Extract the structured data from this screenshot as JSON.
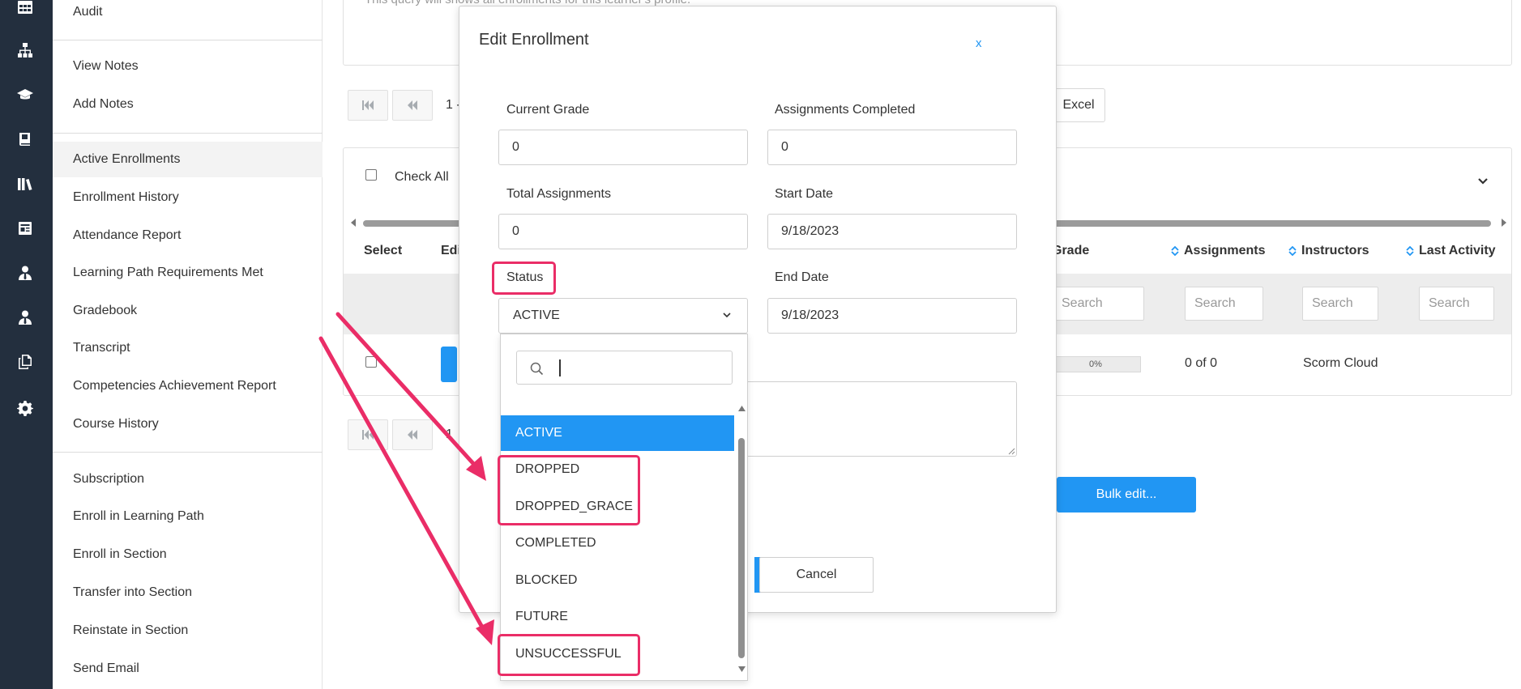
{
  "rail": {
    "icons": [
      "table-icon",
      "sitemap-icon",
      "graduation-cap-icon",
      "book-icon",
      "library-icon",
      "newspaper-icon",
      "user-tie-icon",
      "user-tie-icon",
      "copy-icon",
      "gear-icon"
    ]
  },
  "sidebar": {
    "groups": [
      [
        "Audit"
      ],
      [
        "View Notes",
        "Add Notes"
      ],
      [
        "Active Enrollments",
        "Enrollment History",
        "Attendance Report",
        "Learning Path Requirements Met",
        "Gradebook",
        "Transcript",
        "Competencies Achievement Report",
        "Course History"
      ],
      [
        "Subscription",
        "Enroll in Learning Path",
        "Enroll in Section",
        "Transfer into Section",
        "Reinstate in Section",
        "Send Email"
      ]
    ],
    "active_item": "Active Enrollments"
  },
  "background": {
    "query_text": "This query will shows all enrollments for this learner's profile.",
    "pager_text_top": "1 -",
    "pager_text_bottom": "1",
    "excel_label": "Excel",
    "check_all_label": "Check All",
    "columns": {
      "select": "Select",
      "edit": "Edi",
      "grade": "Grade",
      "assignments": "Assignments",
      "instructors": "Instructors",
      "last_activity": "Last Activity"
    },
    "search_placeholder": "Search",
    "row": {
      "progress": "0%",
      "assignments": "0 of 0",
      "instructor": "Scorm Cloud"
    },
    "bulk_edit_label": "Bulk edit..."
  },
  "modal": {
    "title": "Edit Enrollment",
    "close_label": "x",
    "fields": {
      "current_grade": {
        "label": "Current Grade",
        "value": "0"
      },
      "assignments_completed": {
        "label": "Assignments Completed",
        "value": "0"
      },
      "total_assignments": {
        "label": "Total Assignments",
        "value": "0"
      },
      "start_date": {
        "label": "Start Date",
        "value": "9/18/2023"
      },
      "status": {
        "label": "Status",
        "value": "ACTIVE"
      },
      "end_date": {
        "label": "End Date",
        "value": "9/18/2023"
      }
    },
    "cancel_label": "Cancel"
  },
  "dropdown": {
    "search_value": "",
    "options": [
      "ACTIVE",
      "DROPPED",
      "DROPPED_GRACE",
      "COMPLETED",
      "BLOCKED",
      "FUTURE",
      "UNSUCCESSFUL"
    ],
    "selected": "ACTIVE"
  },
  "colors": {
    "accent": "#2196f3",
    "highlight": "#ea2d67",
    "rail": "#232f3e"
  }
}
